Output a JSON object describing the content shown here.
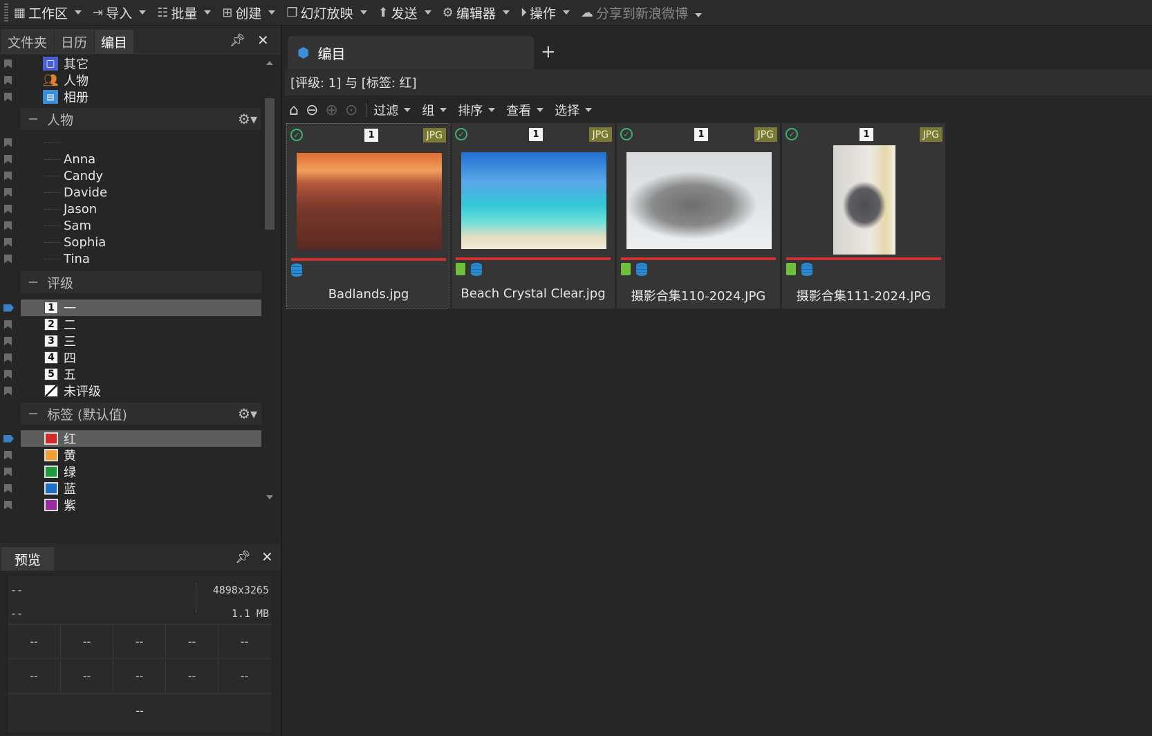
{
  "menubar": {
    "items": [
      {
        "label": "工作区",
        "icon": "grid-icon",
        "caret": true,
        "disabled": false
      },
      {
        "label": "导入",
        "icon": "import-icon",
        "caret": true,
        "disabled": false
      },
      {
        "label": "批量",
        "icon": "batch-icon",
        "caret": true,
        "disabled": false
      },
      {
        "label": "创建",
        "icon": "create-icon",
        "caret": true,
        "disabled": false
      },
      {
        "label": "幻灯放映",
        "icon": "slideshow-icon",
        "caret": true,
        "disabled": false
      },
      {
        "label": "发送",
        "icon": "upload-icon",
        "caret": true,
        "disabled": false
      },
      {
        "label": "编辑器",
        "icon": "gear-icon",
        "caret": true,
        "disabled": false
      },
      {
        "label": "操作",
        "icon": "play-icon",
        "caret": true,
        "disabled": false
      },
      {
        "label": "分享到新浪微博",
        "icon": "weibo-icon",
        "caret": true,
        "disabled": true
      }
    ]
  },
  "left_tabs": {
    "items": [
      "文件夹",
      "日历",
      "编目"
    ],
    "active": 2
  },
  "tree": {
    "top_items": [
      {
        "label": "其它",
        "icon": "box-icon",
        "color": "#4a5fd0"
      },
      {
        "label": "人物",
        "icon": "people-icon",
        "color": "#e08030"
      },
      {
        "label": "相册",
        "icon": "album-icon",
        "color": "#3b8fd6"
      }
    ],
    "people_group": "人物",
    "people": [
      "Anna",
      "Candy",
      "Davide",
      "Jason",
      "Sam",
      "Sophia",
      "Tina"
    ],
    "rating_group": "评级",
    "ratings": [
      {
        "num": "1",
        "label": "一",
        "selected": true
      },
      {
        "num": "2",
        "label": "二",
        "selected": false
      },
      {
        "num": "3",
        "label": "三",
        "selected": false
      },
      {
        "num": "4",
        "label": "四",
        "selected": false
      },
      {
        "num": "5",
        "label": "五",
        "selected": false
      },
      {
        "num": "",
        "label": "未评级",
        "selected": false
      }
    ],
    "tag_group": "标签 (默认值)",
    "tags": [
      {
        "label": "红",
        "color": "#d42a2a",
        "selected": true
      },
      {
        "label": "黄",
        "color": "#f0a030",
        "selected": false
      },
      {
        "label": "绿",
        "color": "#1e9a3c",
        "selected": false
      },
      {
        "label": "蓝",
        "color": "#1e6fc8",
        "selected": false
      },
      {
        "label": "紫",
        "color": "#9a2aa0",
        "selected": false
      }
    ]
  },
  "preview": {
    "tab": "预览",
    "left_top": "--",
    "left_bottom": "--",
    "dimensions": "4898x3265",
    "filesize": "1.1 MB",
    "grid_row1": [
      "--",
      "--",
      "--",
      "--",
      "--"
    ],
    "grid_row2": [
      "--",
      "--",
      "--",
      "--",
      "--"
    ],
    "bottom": "--"
  },
  "main": {
    "doc_tab": "编目",
    "filter_text": "[评级: 1] 与 [标签: 红]",
    "toolbar": [
      "过滤",
      "组",
      "排序",
      "查看",
      "选择"
    ],
    "thumbs": [
      {
        "name": "Badlands.jpg",
        "rating": "1",
        "format": "JPG",
        "lock": false,
        "image": "badlands"
      },
      {
        "name": "Beach Crystal Clear.jpg",
        "rating": "1",
        "format": "JPG",
        "lock": true,
        "image": "beach"
      },
      {
        "name": "摄影合集110-2024.JPG",
        "rating": "1",
        "format": "JPG",
        "lock": true,
        "image": "cat"
      },
      {
        "name": "摄影合集111-2024.JPG",
        "rating": "1",
        "format": "JPG",
        "lock": true,
        "image": "cat2"
      }
    ]
  }
}
